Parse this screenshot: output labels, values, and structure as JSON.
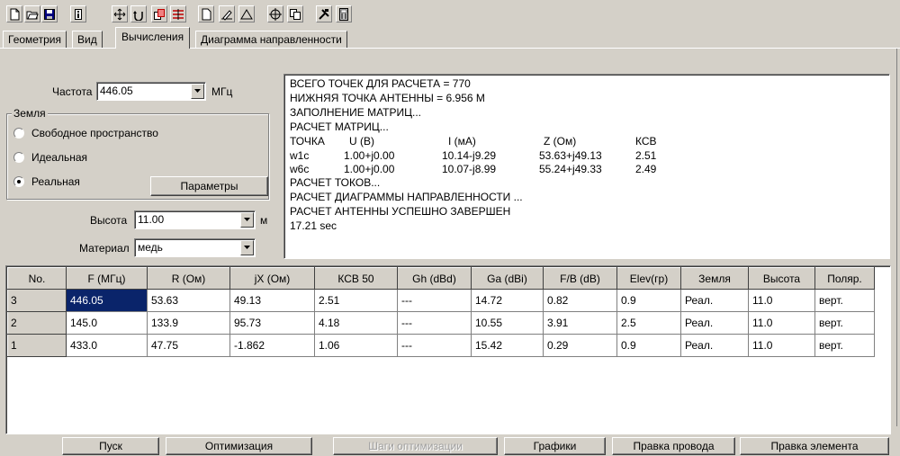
{
  "toolbar": {
    "buttons": [
      "new-file-icon",
      "open-folder-icon",
      "save-icon",
      "info-icon",
      "move-icon",
      "rotate-icon",
      "copy-icon",
      "segments-icon",
      "page-icon",
      "draw-icon",
      "triangle-icon",
      "target-icon",
      "duplicate-icon",
      "tools-icon",
      "calculator-icon"
    ]
  },
  "tabs": [
    "Геометрия",
    "Вид",
    "Вычисления",
    "Диаграмма направленности"
  ],
  "active_tab": "Вычисления",
  "frequency": {
    "label": "Частота",
    "value": "446.05",
    "unit": "МГц"
  },
  "ground": {
    "title": "Земля",
    "options": [
      "Свободное пространство",
      "Идеальная",
      "Реальная"
    ],
    "selected": "Реальная",
    "params_button": "Параметры"
  },
  "height": {
    "label": "Высота",
    "value": "11.00",
    "unit": "м"
  },
  "material": {
    "label": "Материал",
    "value": "медь"
  },
  "log": {
    "lines_top": [
      "ВСЕГО ТОЧЕК ДЛЯ РАСЧЕТА = 770",
      "НИЖНЯЯ ТОЧКА АНТЕННЫ = 6.956 М",
      "ЗАПОЛНЕНИЕ МАТРИЦ...",
      "РАСЧЕТ МАТРИЦ..."
    ],
    "table_header": [
      "ТОЧКА",
      "U (В)",
      "I (мА)",
      "Z (Ом)",
      "КСВ"
    ],
    "table_rows": [
      [
        "w1c",
        "1.00+j0.00",
        "10.14-j9.29",
        "53.63+j49.13",
        "2.51"
      ],
      [
        "w6c",
        "1.00+j0.00",
        "10.07-j8.99",
        "55.24+j49.33",
        "2.49"
      ]
    ],
    "lines_bottom": [
      "РАСЧЕТ ТОКОВ...",
      "РАСЧЕТ ДИАГРАММЫ НАПРАВЛЕННОСТИ ...",
      "РАСЧЕТ АНТЕННЫ УСПЕШНО ЗАВЕРШЕН",
      "17.21 sec"
    ]
  },
  "results": {
    "columns": [
      "No.",
      "F (МГц)",
      "R (Ом)",
      "jX (Ом)",
      "КСВ 50",
      "Gh (dBd)",
      "Ga (dBi)",
      "F/B (dB)",
      "Elev(гр)",
      "Земля",
      "Высота",
      "Поляр."
    ],
    "rows": [
      [
        "3",
        "446.05",
        "53.63",
        "49.13",
        "2.51",
        "---",
        "14.72",
        "0.82",
        "0.9",
        "Реал.",
        "11.0",
        "верт."
      ],
      [
        "2",
        "145.0",
        "133.9",
        "95.73",
        "4.18",
        "---",
        "10.55",
        "3.91",
        "2.5",
        "Реал.",
        "11.0",
        "верт."
      ],
      [
        "1",
        "433.0",
        "47.75",
        "-1.862",
        "1.06",
        "---",
        "15.42",
        "0.29",
        "0.9",
        "Реал.",
        "11.0",
        "верт."
      ]
    ]
  },
  "bottom_buttons": {
    "start": "Пуск",
    "optimize": "Оптимизация",
    "opt_steps": "Шаги оптимизации",
    "graphs": "Графики",
    "edit_wire": "Правка провода",
    "edit_element": "Правка элемента"
  }
}
